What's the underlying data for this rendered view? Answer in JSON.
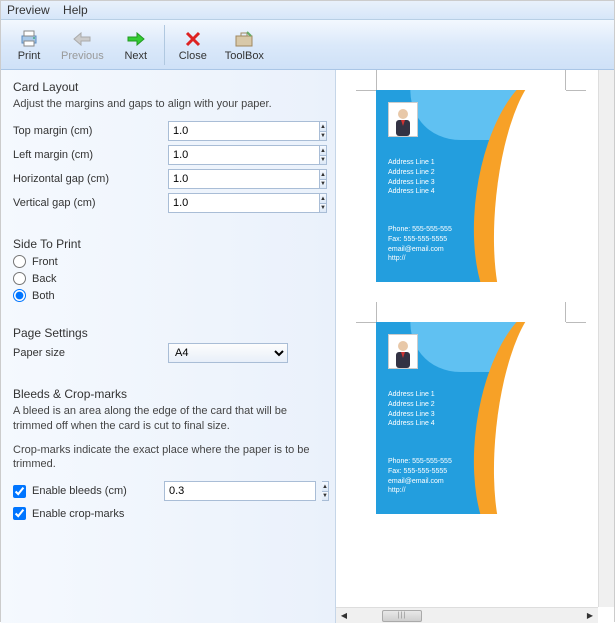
{
  "menu": {
    "preview": "Preview",
    "help": "Help"
  },
  "toolbar": {
    "print": "Print",
    "previous": "Previous",
    "next": "Next",
    "close": "Close",
    "toolbox": "ToolBox"
  },
  "layout": {
    "title": "Card Layout",
    "desc": "Adjust the margins and gaps to align with your paper.",
    "top_margin_label": "Top margin (cm)",
    "top_margin_value": "1.0",
    "left_margin_label": "Left margin (cm)",
    "left_margin_value": "1.0",
    "hgap_label": "Horizontal gap (cm)",
    "hgap_value": "1.0",
    "vgap_label": "Vertical gap (cm)",
    "vgap_value": "1.0"
  },
  "side": {
    "title": "Side To Print",
    "front": "Front",
    "back": "Back",
    "both": "Both",
    "selected": "both"
  },
  "page": {
    "title": "Page Settings",
    "size_label": "Paper size",
    "size_value": "A4"
  },
  "bleeds": {
    "title": "Bleeds & Crop-marks",
    "desc1": "A bleed is an area along the edge of the card that will be trimmed off when the card is cut to final size.",
    "desc2": "Crop-marks indicate the exact place where the paper is to be trimmed.",
    "enable_bleeds_label": "Enable bleeds (cm)",
    "enable_bleeds_value": "0.3",
    "enable_crop_label": "Enable crop-marks"
  },
  "card": {
    "addr1": "Address Line 1",
    "addr2": "Address Line 2",
    "addr3": "Address Line 3",
    "addr4": "Address Line 4",
    "phone": "Phone: 555-555-555",
    "fax": "Fax: 555-555-5555",
    "email": "email@email.com",
    "url": "http://"
  }
}
